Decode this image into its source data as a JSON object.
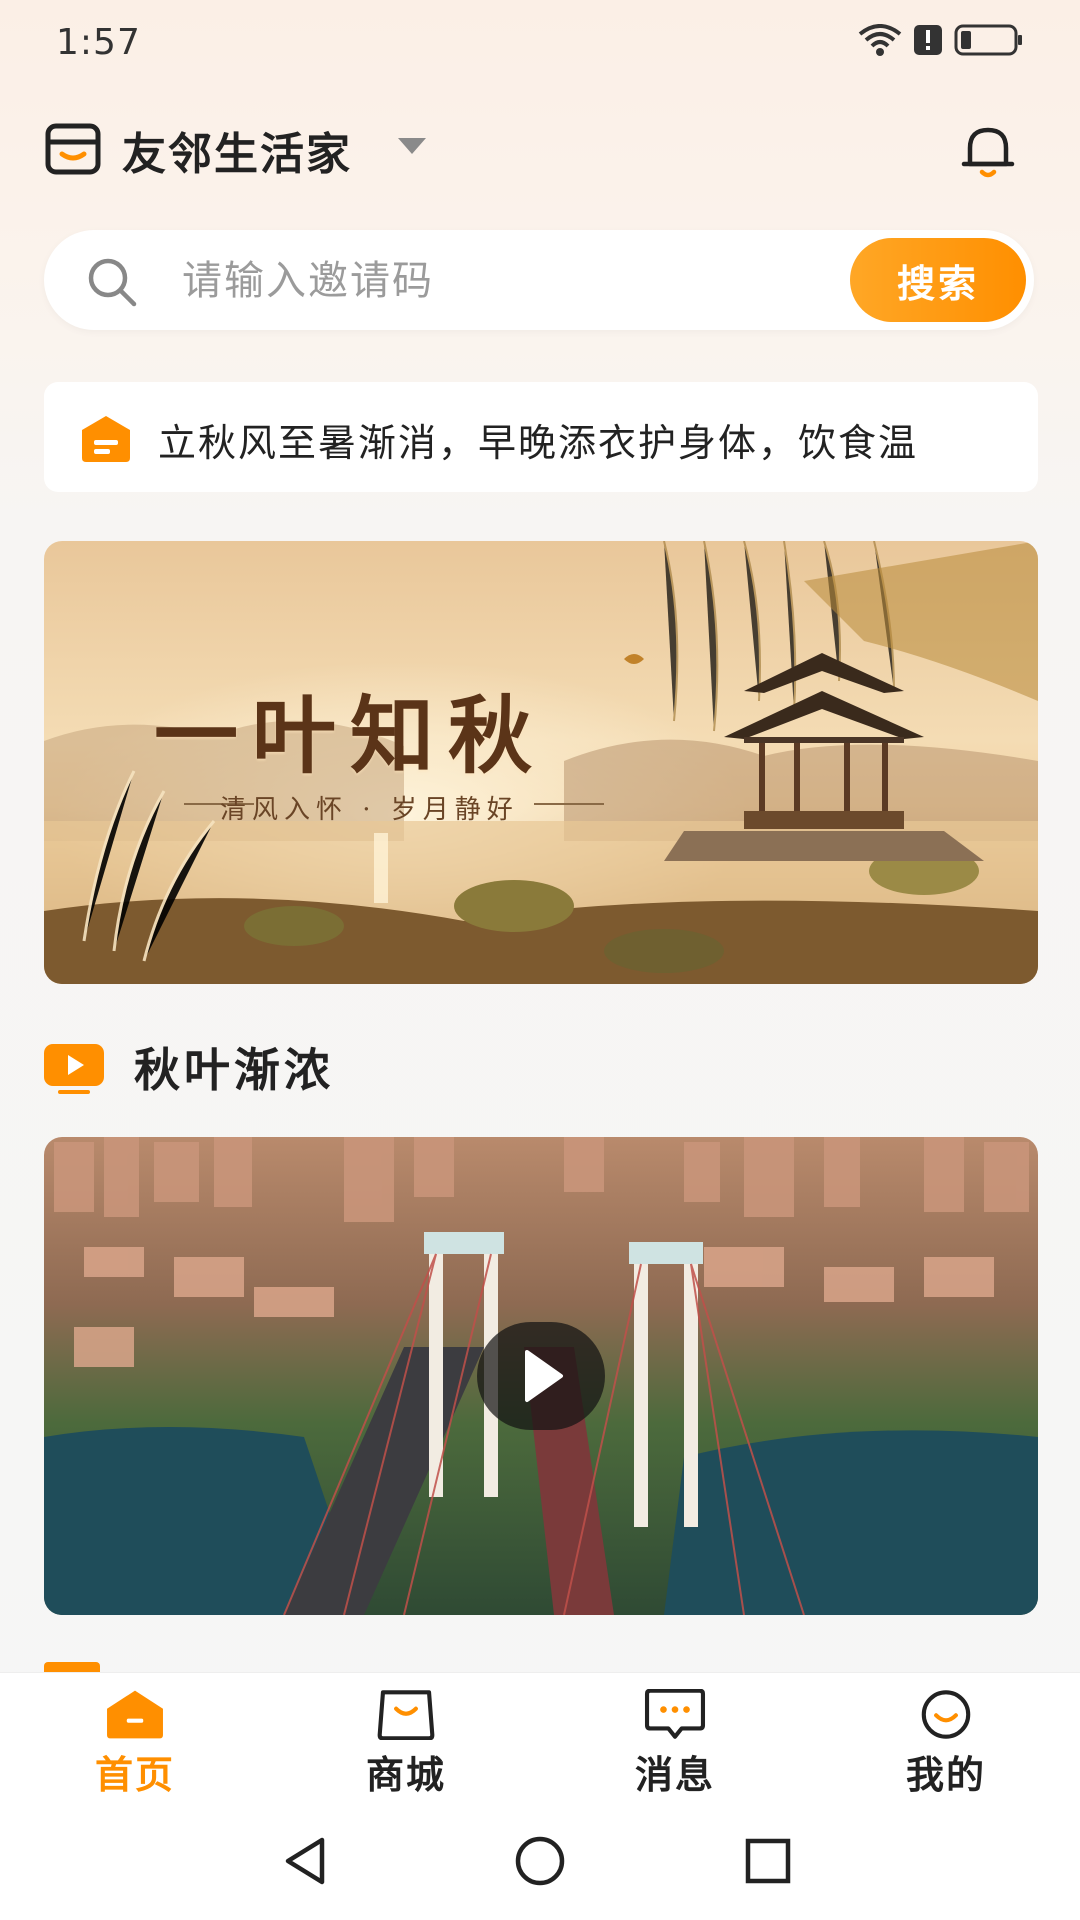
{
  "status_bar": {
    "time": "1:57"
  },
  "header": {
    "title": "友邻生活家"
  },
  "search": {
    "placeholder": "请输入邀请码",
    "button_label": "搜索"
  },
  "notice": {
    "text": "立秋风至暑渐消，早晚添衣护身体，饮食温"
  },
  "banner": {
    "title": "一叶知秋",
    "subtitle": "清风入怀 · 岁月静好"
  },
  "section": {
    "title": "秋叶渐浓"
  },
  "tabs": [
    {
      "label": "首页",
      "icon": "home-icon",
      "active": true
    },
    {
      "label": "商城",
      "icon": "shopping-bag-icon",
      "active": false
    },
    {
      "label": "消息",
      "icon": "message-icon",
      "active": false
    },
    {
      "label": "我的",
      "icon": "profile-icon",
      "active": false
    }
  ],
  "colors": {
    "accent": "#ff8f00",
    "accent_light": "#ffa726",
    "text": "#222222",
    "placeholder": "#9b9b9b"
  }
}
